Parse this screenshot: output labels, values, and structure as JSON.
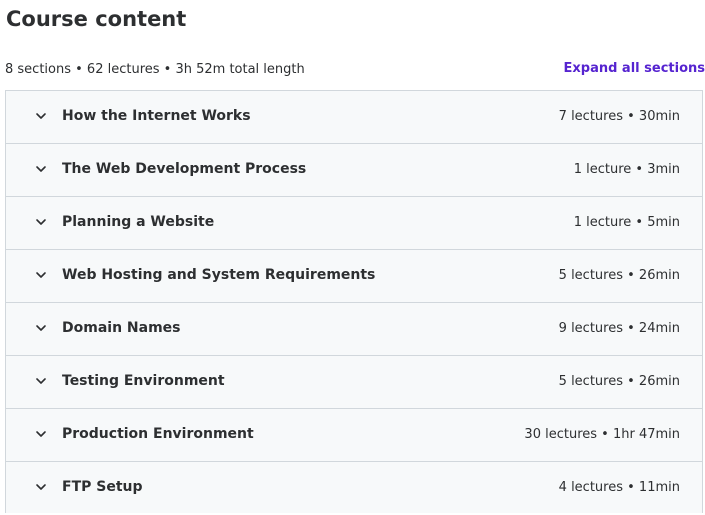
{
  "header": {
    "title": "Course content"
  },
  "summary": {
    "text": "8 sections • 62 lectures • 3h 52m total length",
    "expand_all_label": "Expand all sections"
  },
  "colors": {
    "accent": "#5624d0",
    "text": "#2d2f31",
    "section_bg": "#f7f9fa",
    "border": "#d1d7dc"
  },
  "sections": [
    {
      "title": "How the Internet Works",
      "meta": "7 lectures • 30min",
      "icon": "chevron-down-icon"
    },
    {
      "title": "The Web Development Process",
      "meta": "1 lecture • 3min",
      "icon": "chevron-down-icon"
    },
    {
      "title": "Planning a Website",
      "meta": "1 lecture • 5min",
      "icon": "chevron-down-icon"
    },
    {
      "title": "Web Hosting and System Requirements",
      "meta": "5 lectures • 26min",
      "icon": "chevron-down-icon"
    },
    {
      "title": "Domain Names",
      "meta": "9 lectures • 24min",
      "icon": "chevron-down-icon"
    },
    {
      "title": "Testing Environment",
      "meta": "5 lectures • 26min",
      "icon": "chevron-down-icon"
    },
    {
      "title": "Production Environment",
      "meta": "30 lectures • 1hr 47min",
      "icon": "chevron-down-icon"
    },
    {
      "title": "FTP Setup",
      "meta": "4 lectures • 11min",
      "icon": "chevron-down-icon"
    }
  ]
}
